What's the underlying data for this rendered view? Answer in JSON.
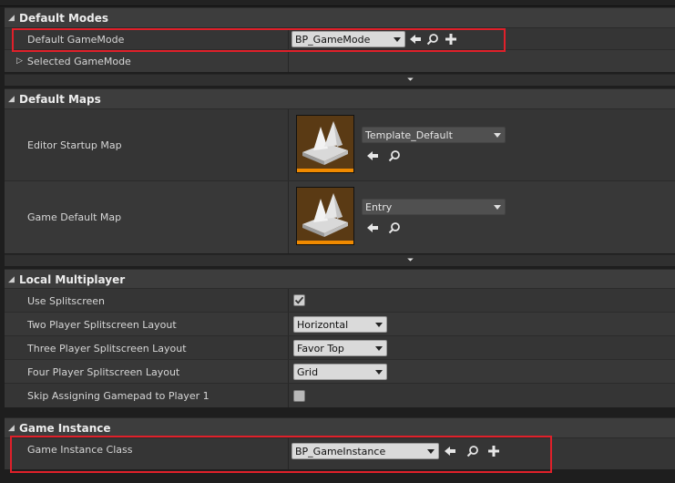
{
  "sections": {
    "default_modes": {
      "title": "Default Modes",
      "rows": {
        "default_gamemode": {
          "label": "Default GameMode",
          "value": "BP_GameMode"
        },
        "selected_gamemode": {
          "label": "Selected GameMode"
        }
      }
    },
    "default_maps": {
      "title": "Default Maps",
      "rows": {
        "editor_startup_map": {
          "label": "Editor Startup Map",
          "value": "Template_Default"
        },
        "game_default_map": {
          "label": "Game Default Map",
          "value": "Entry"
        }
      }
    },
    "local_multiplayer": {
      "title": "Local Multiplayer",
      "rows": {
        "use_splitscreen": {
          "label": "Use Splitscreen",
          "checked": true
        },
        "two_player": {
          "label": "Two Player Splitscreen Layout",
          "value": "Horizontal"
        },
        "three_player": {
          "label": "Three Player Splitscreen Layout",
          "value": "Favor Top"
        },
        "four_player": {
          "label": "Four Player Splitscreen Layout",
          "value": "Grid"
        },
        "skip_gamepad": {
          "label": "Skip Assigning Gamepad to Player 1",
          "checked": false
        }
      }
    },
    "game_instance": {
      "title": "Game Instance",
      "rows": {
        "game_instance_class": {
          "label": "Game Instance Class",
          "value": "BP_GameInstance"
        }
      }
    }
  },
  "colors": {
    "highlight": "#e0202a",
    "thumb_accent": "#f08a00"
  },
  "icons": [
    "use-selected-arrow-icon",
    "browse-magnifier-icon",
    "add-plus-icon",
    "expand-triangle-icon",
    "collapse-triangle-icon",
    "advanced-chevron-icon"
  ]
}
